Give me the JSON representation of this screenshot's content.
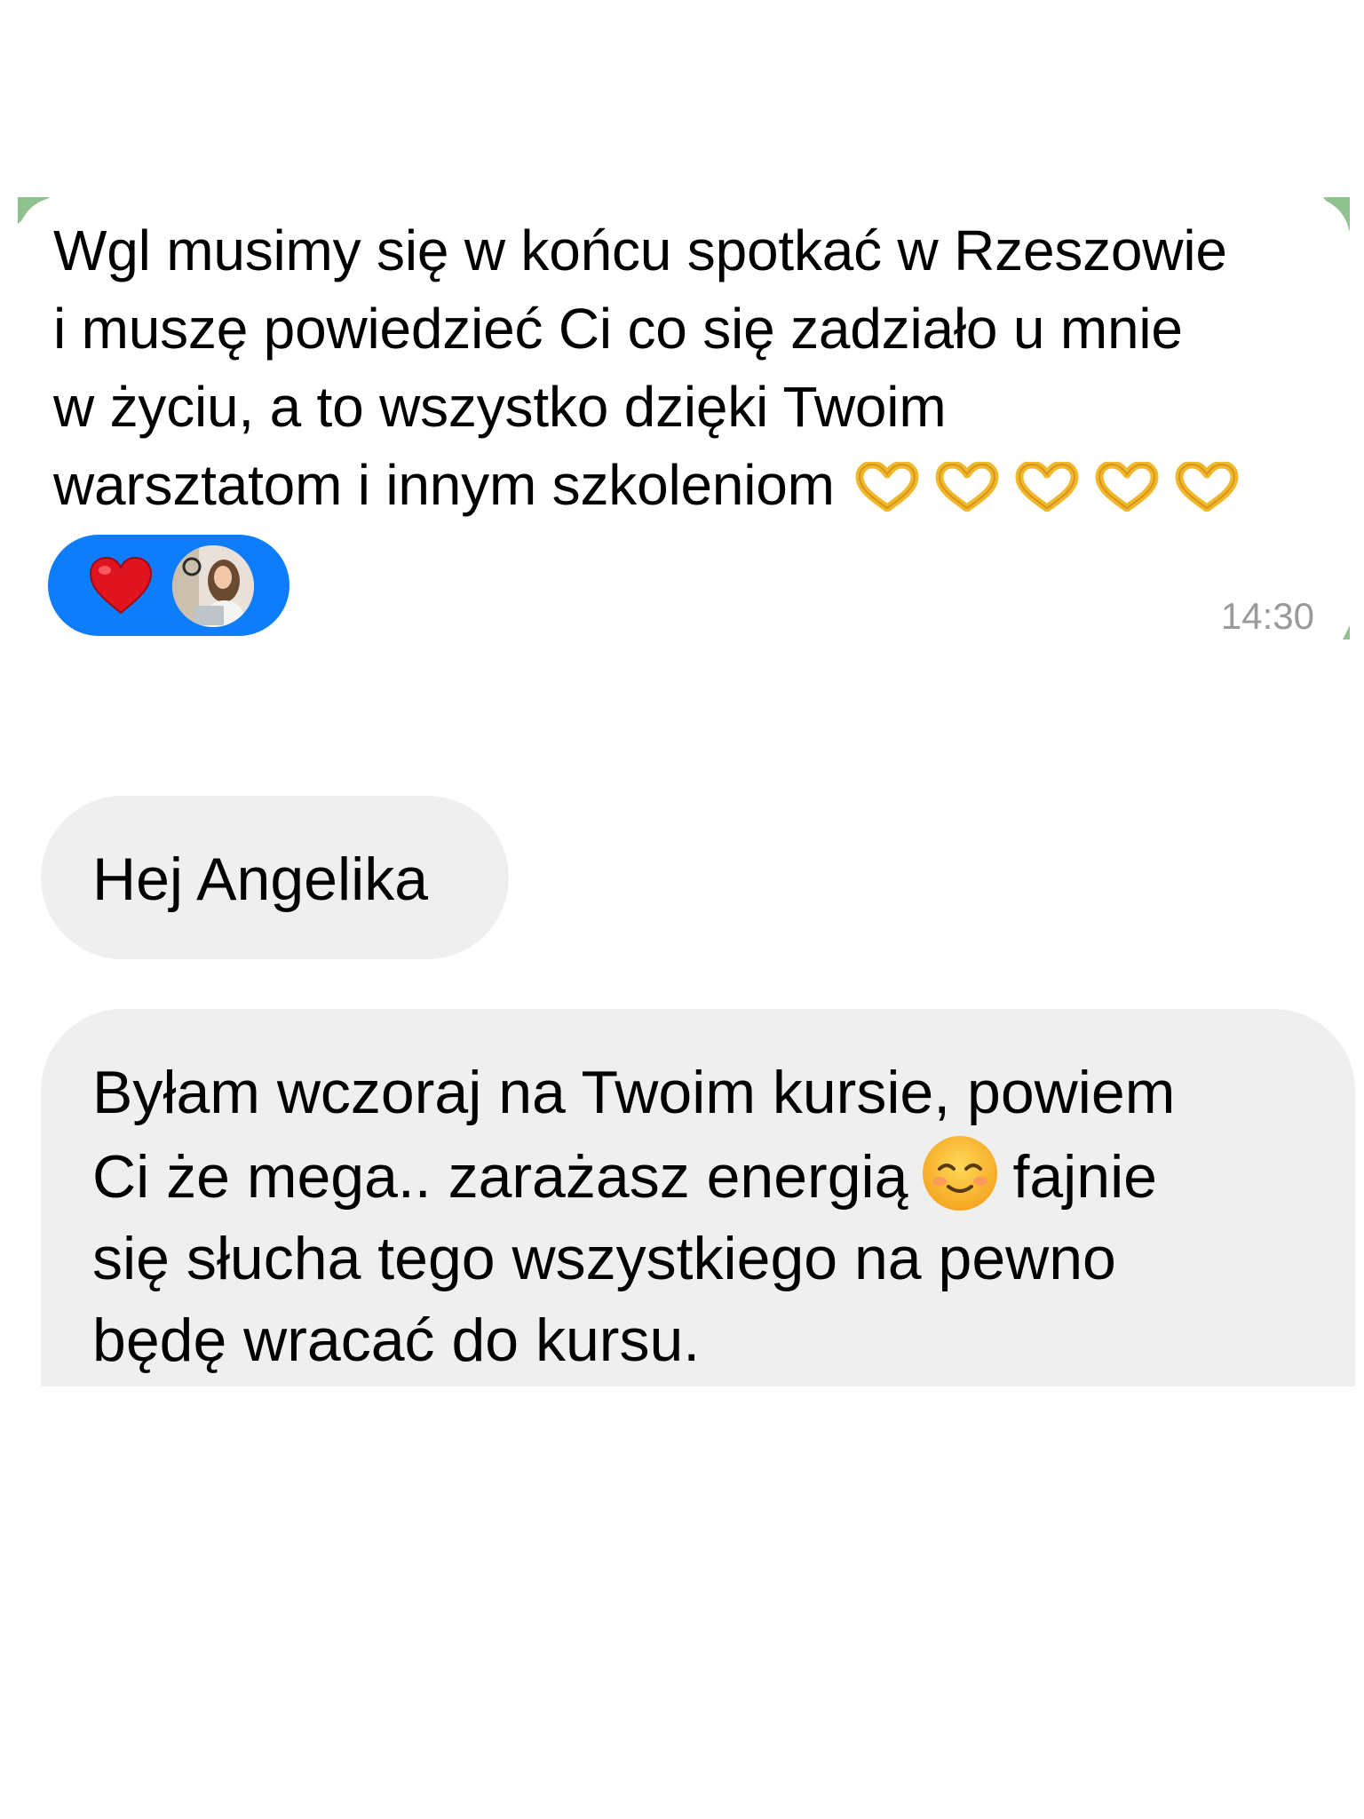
{
  "messages": [
    {
      "text_line1": "Wgl musimy się w końcu spotkać w Rzeszowie",
      "text_line2": "i muszę powiedzieć Ci co się zadziało u mnie",
      "text_line3": "w życiu, a to wszystko dzięki Twoim",
      "text_line4": "warsztatom i innym szkoleniom",
      "emoji_icons": [
        "heart-hands-icon",
        "heart-hands-icon",
        "heart-hands-icon",
        "heart-hands-icon",
        "heart-hands-icon"
      ],
      "reaction": {
        "emoji_icon": "red-heart-icon",
        "avatar": "avatar-woman",
        "background": "#0d7dfb"
      },
      "time": "14:30",
      "accent": "#8fc28e"
    },
    {
      "text": "Hej Angelika",
      "bubble_color": "#efefef"
    },
    {
      "text_line1": "Byłam wczoraj na Twoim kursie, powiem",
      "text_line2a": "Ci że mega.. zarażasz energią",
      "text_line2b": "fajnie",
      "text_line3": "się słucha tego wszystkiego na pewno",
      "text_line4": "będę wracać do kursu.",
      "emoji_icon": "smiling-face-icon",
      "bubble_color": "#efefef"
    }
  ]
}
